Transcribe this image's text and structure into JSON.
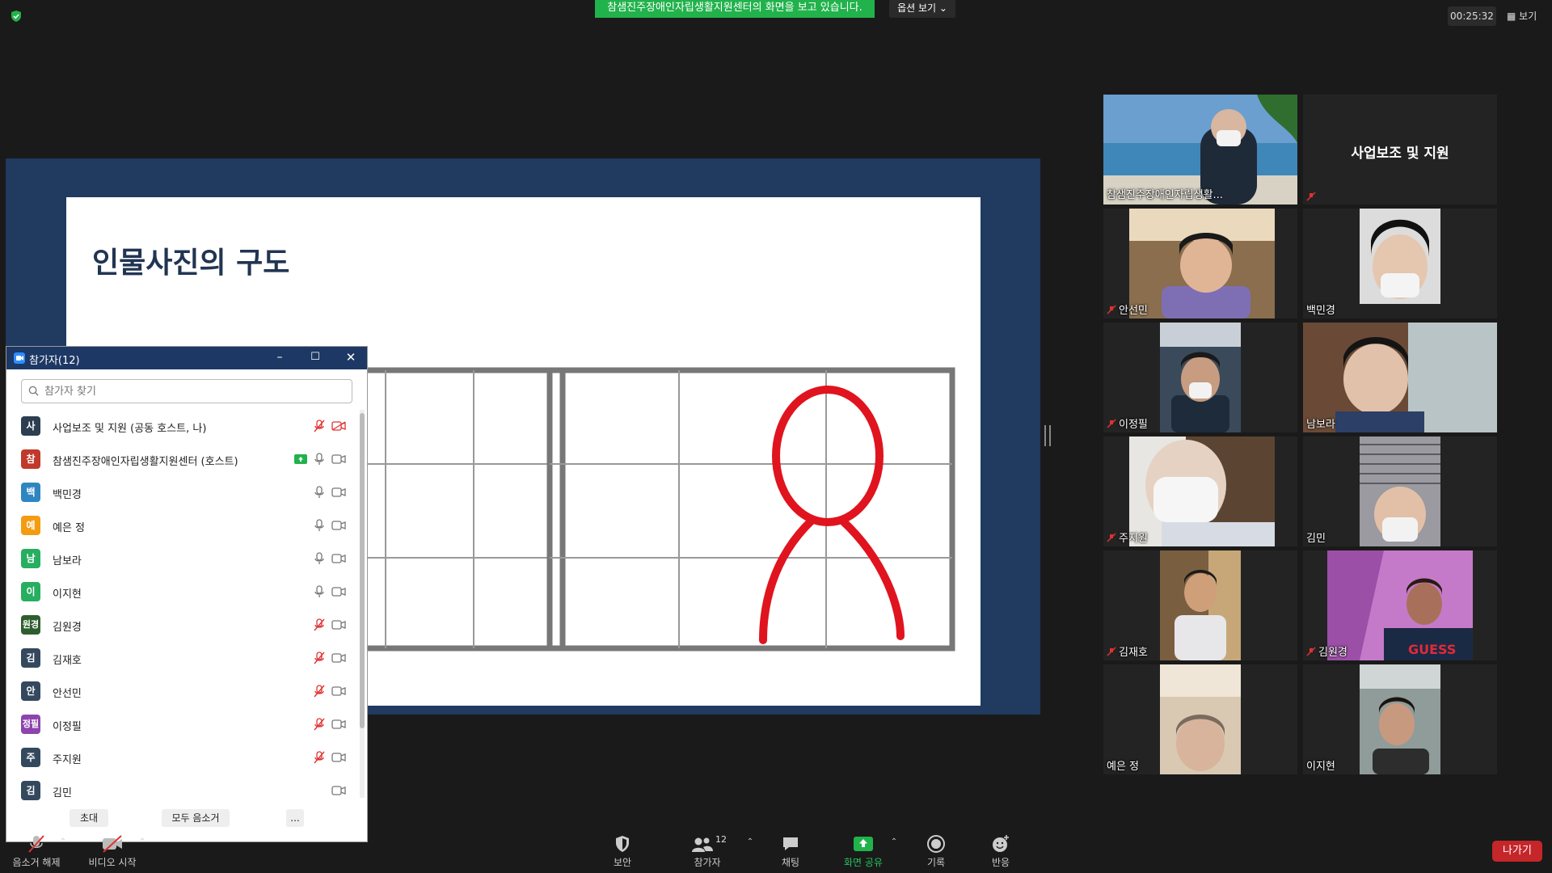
{
  "top": {
    "share_banner": "참샘진주장애인자립생활지원센터의 화면을 보고 있습니다.",
    "view_options": "옵션 보기 ⌄",
    "timer": "00:25:32",
    "view_label": "보기"
  },
  "slide": {
    "title": "인물사진의 구도"
  },
  "gallery": [
    {
      "name": "참샘진주장애인자립생활..."
    },
    {
      "name": "사업보조 및 지원"
    },
    {
      "name": "안선민"
    },
    {
      "name": "백민경"
    },
    {
      "name": "이정필"
    },
    {
      "name": "남보라"
    },
    {
      "name": "주지원"
    },
    {
      "name": "김민"
    },
    {
      "name": "김재호"
    },
    {
      "name": "김원경"
    },
    {
      "name": "예은 정"
    },
    {
      "name": "이지현"
    }
  ],
  "panel": {
    "title": "참가자(12)",
    "search_placeholder": "참가자 찾기",
    "participants": [
      {
        "avatar": "사",
        "name": "사업보조 및 지원 (공동 호스트, 나)",
        "color": "#2c3e50"
      },
      {
        "avatar": "참",
        "name": "참샘진주장애인자립생활지원센터 (호스트)",
        "color": "#c0392b"
      },
      {
        "avatar": "백",
        "name": "백민경",
        "color": "#2e86c1"
      },
      {
        "avatar": "예",
        "name": "예은 정",
        "color": "#f39c12"
      },
      {
        "avatar": "남",
        "name": "남보라",
        "color": "#27ae60"
      },
      {
        "avatar": "이",
        "name": "이지현",
        "color": "#27ae60"
      },
      {
        "avatar": "원경",
        "name": "김원경",
        "color": "#2e5e2e"
      },
      {
        "avatar": "김",
        "name": "김재호",
        "color": "#34495e"
      },
      {
        "avatar": "안",
        "name": "안선민",
        "color": "#34495e"
      },
      {
        "avatar": "정필",
        "name": "이정필",
        "color": "#8e44ad"
      },
      {
        "avatar": "주",
        "name": "주지원",
        "color": "#34495e"
      },
      {
        "avatar": "김",
        "name": "김민",
        "color": "#34495e"
      }
    ],
    "invite": "초대",
    "mute_all": "모두 음소거",
    "more": "..."
  },
  "toolbar": {
    "unmute": "음소거 해제",
    "start_video": "비디오 시작",
    "security": "보안",
    "participants": "참가자",
    "participants_count": "12",
    "chat": "채팅",
    "share_screen": "화면 공유",
    "record": "기록",
    "reactions": "반응",
    "leave": "나가기"
  }
}
